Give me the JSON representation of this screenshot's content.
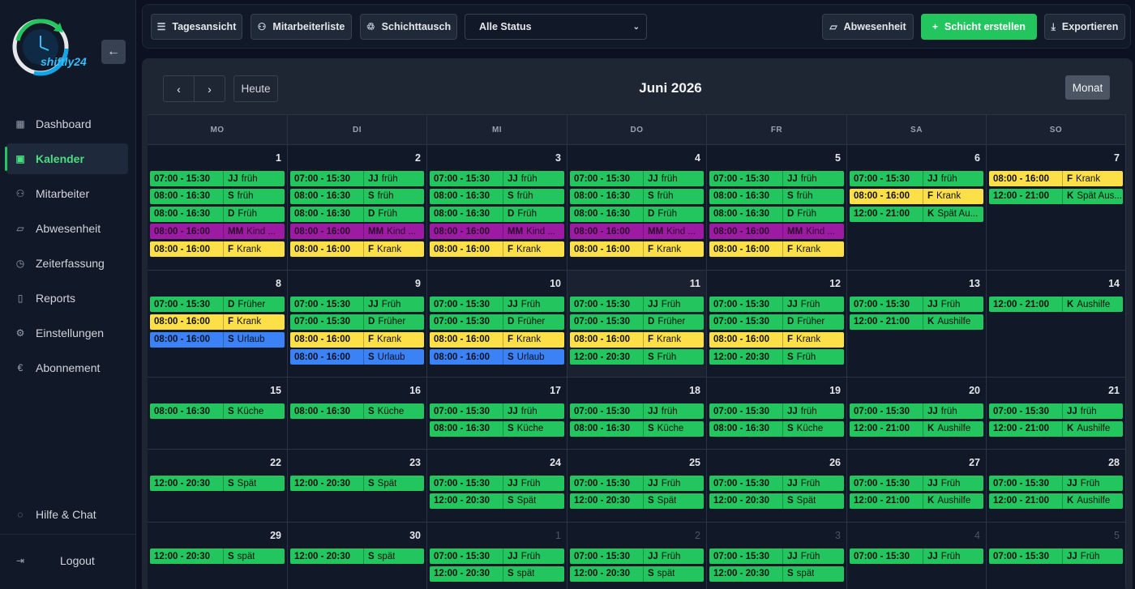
{
  "app": {
    "logo_text": "shiftly24"
  },
  "sidebar": {
    "items": [
      {
        "label": "Dashboard",
        "icon": "grid-icon",
        "glyph": "▦"
      },
      {
        "label": "Kalender",
        "icon": "calendar-icon",
        "glyph": "▣",
        "active": true
      },
      {
        "label": "Mitarbeiter",
        "icon": "user-icon",
        "glyph": "⚇"
      },
      {
        "label": "Abwesenheit",
        "icon": "folder-icon",
        "glyph": "▱"
      },
      {
        "label": "Zeiterfassung",
        "icon": "stopwatch-icon",
        "glyph": "◷"
      },
      {
        "label": "Reports",
        "icon": "book-icon",
        "glyph": "▯"
      },
      {
        "label": "Einstellungen",
        "icon": "gear-icon",
        "glyph": "⚙"
      },
      {
        "label": "Abonnement",
        "icon": "euro-icon",
        "glyph": "€"
      }
    ],
    "help": "Hilfe & Chat",
    "logout": "Logout"
  },
  "toolbar": {
    "tagesansicht": "Tagesansicht",
    "mitarbeiterliste": "Mitarbeiterliste",
    "schichttausch": "Schichttausch",
    "status_value": "Alle Status",
    "abwesenheit": "Abwesenheit",
    "schicht_erstellen": "Schicht erstellen",
    "exportieren": "Exportieren"
  },
  "calendar": {
    "title": "Juni 2026",
    "heute": "Heute",
    "view": "Monat",
    "weekdays": [
      "MO",
      "DI",
      "MI",
      "DO",
      "FR",
      "SA",
      "SO"
    ],
    "colors": {
      "g": "#22c55e",
      "y": "#fde047",
      "p": "#9d1ba3",
      "b": "#3b82f6"
    },
    "weeks": [
      [
        {
          "day": "1",
          "events": [
            [
              "07:00 - 15:30",
              "JJ",
              "früh",
              "g"
            ],
            [
              "08:00 - 16:30",
              "S",
              "früh",
              "g"
            ],
            [
              "08:00 - 16:30",
              "D",
              "Früh",
              "g"
            ],
            [
              "08:00 - 16:00",
              "MM",
              "Kind ...",
              "p"
            ],
            [
              "08:00 - 16:00",
              "F",
              "Krank",
              "y"
            ]
          ]
        },
        {
          "day": "2",
          "events": [
            [
              "07:00 - 15:30",
              "JJ",
              "früh",
              "g"
            ],
            [
              "08:00 - 16:30",
              "S",
              "früh",
              "g"
            ],
            [
              "08:00 - 16:30",
              "D",
              "Früh",
              "g"
            ],
            [
              "08:00 - 16:00",
              "MM",
              "Kind ...",
              "p"
            ],
            [
              "08:00 - 16:00",
              "F",
              "Krank",
              "y"
            ]
          ]
        },
        {
          "day": "3",
          "events": [
            [
              "07:00 - 15:30",
              "JJ",
              "früh",
              "g"
            ],
            [
              "08:00 - 16:30",
              "S",
              "früh",
              "g"
            ],
            [
              "08:00 - 16:30",
              "D",
              "Früh",
              "g"
            ],
            [
              "08:00 - 16:00",
              "MM",
              "Kind ...",
              "p"
            ],
            [
              "08:00 - 16:00",
              "F",
              "Krank",
              "y"
            ]
          ]
        },
        {
          "day": "4",
          "events": [
            [
              "07:00 - 15:30",
              "JJ",
              "früh",
              "g"
            ],
            [
              "08:00 - 16:30",
              "S",
              "früh",
              "g"
            ],
            [
              "08:00 - 16:30",
              "D",
              "Früh",
              "g"
            ],
            [
              "08:00 - 16:00",
              "MM",
              "Kind ...",
              "p"
            ],
            [
              "08:00 - 16:00",
              "F",
              "Krank",
              "y"
            ]
          ]
        },
        {
          "day": "5",
          "events": [
            [
              "07:00 - 15:30",
              "JJ",
              "früh",
              "g"
            ],
            [
              "08:00 - 16:30",
              "S",
              "früh",
              "g"
            ],
            [
              "08:00 - 16:30",
              "D",
              "Früh",
              "g"
            ],
            [
              "08:00 - 16:00",
              "MM",
              "Kind ...",
              "p"
            ],
            [
              "08:00 - 16:00",
              "F",
              "Krank",
              "y"
            ]
          ]
        },
        {
          "day": "6",
          "events": [
            [
              "07:00 - 15:30",
              "JJ",
              "früh",
              "g"
            ],
            [
              "08:00 - 16:00",
              "F",
              "Krank",
              "y"
            ],
            [
              "12:00 - 21:00",
              "K",
              "Spät Au...",
              "g"
            ]
          ]
        },
        {
          "day": "7",
          "events": [
            [
              "08:00 - 16:00",
              "F",
              "Krank",
              "y"
            ],
            [
              "12:00 - 21:00",
              "K",
              "Spät Aus...",
              "g"
            ]
          ]
        }
      ],
      [
        {
          "day": "8",
          "events": [
            [
              "07:00 - 15:30",
              "D",
              "Früher",
              "g"
            ],
            [
              "08:00 - 16:00",
              "F",
              "Krank",
              "y"
            ],
            [
              "08:00 - 16:00",
              "S",
              "Urlaub",
              "b"
            ]
          ]
        },
        {
          "day": "9",
          "events": [
            [
              "07:00 - 15:30",
              "JJ",
              "Früh",
              "g"
            ],
            [
              "07:00 - 15:30",
              "D",
              "Früher",
              "g"
            ],
            [
              "08:00 - 16:00",
              "F",
              "Krank",
              "y"
            ],
            [
              "08:00 - 16:00",
              "S",
              "Urlaub",
              "b"
            ]
          ]
        },
        {
          "day": "10",
          "events": [
            [
              "07:00 - 15:30",
              "JJ",
              "Früh",
              "g"
            ],
            [
              "07:00 - 15:30",
              "D",
              "Früher",
              "g"
            ],
            [
              "08:00 - 16:00",
              "F",
              "Krank",
              "y"
            ],
            [
              "08:00 - 16:00",
              "S",
              "Urlaub",
              "b"
            ]
          ]
        },
        {
          "day": "11",
          "today": true,
          "events": [
            [
              "07:00 - 15:30",
              "JJ",
              "Früh",
              "g"
            ],
            [
              "07:00 - 15:30",
              "D",
              "Früher",
              "g"
            ],
            [
              "08:00 - 16:00",
              "F",
              "Krank",
              "y"
            ],
            [
              "12:00 - 20:30",
              "S",
              "Früh",
              "g"
            ]
          ]
        },
        {
          "day": "12",
          "events": [
            [
              "07:00 - 15:30",
              "JJ",
              "Früh",
              "g"
            ],
            [
              "07:00 - 15:30",
              "D",
              "Früher",
              "g"
            ],
            [
              "08:00 - 16:00",
              "F",
              "Krank",
              "y"
            ],
            [
              "12:00 - 20:30",
              "S",
              "Früh",
              "g"
            ]
          ]
        },
        {
          "day": "13",
          "events": [
            [
              "07:00 - 15:30",
              "JJ",
              "Früh",
              "g"
            ],
            [
              "12:00 - 21:00",
              "K",
              "Aushilfe",
              "g"
            ]
          ]
        },
        {
          "day": "14",
          "events": [
            [
              "12:00 - 21:00",
              "K",
              "Aushilfe",
              "g"
            ]
          ]
        }
      ],
      [
        {
          "day": "15",
          "events": [
            [
              "08:00 - 16:30",
              "S",
              "Küche",
              "g"
            ]
          ]
        },
        {
          "day": "16",
          "events": [
            [
              "08:00 - 16:30",
              "S",
              "Küche",
              "g"
            ]
          ]
        },
        {
          "day": "17",
          "events": [
            [
              "07:00 - 15:30",
              "JJ",
              "früh",
              "g"
            ],
            [
              "08:00 - 16:30",
              "S",
              "Küche",
              "g"
            ]
          ]
        },
        {
          "day": "18",
          "events": [
            [
              "07:00 - 15:30",
              "JJ",
              "früh",
              "g"
            ],
            [
              "08:00 - 16:30",
              "S",
              "Küche",
              "g"
            ]
          ]
        },
        {
          "day": "19",
          "events": [
            [
              "07:00 - 15:30",
              "JJ",
              "früh",
              "g"
            ],
            [
              "08:00 - 16:30",
              "S",
              "Küche",
              "g"
            ]
          ]
        },
        {
          "day": "20",
          "events": [
            [
              "07:00 - 15:30",
              "JJ",
              "früh",
              "g"
            ],
            [
              "12:00 - 21:00",
              "K",
              "Aushilfe",
              "g"
            ]
          ]
        },
        {
          "day": "21",
          "events": [
            [
              "07:00 - 15:30",
              "JJ",
              "früh",
              "g"
            ],
            [
              "12:00 - 21:00",
              "K",
              "Aushilfe",
              "g"
            ]
          ]
        }
      ],
      [
        {
          "day": "22",
          "events": [
            [
              "12:00 - 20:30",
              "S",
              "Spät",
              "g"
            ]
          ]
        },
        {
          "day": "23",
          "events": [
            [
              "12:00 - 20:30",
              "S",
              "Spät",
              "g"
            ]
          ]
        },
        {
          "day": "24",
          "events": [
            [
              "07:00 - 15:30",
              "JJ",
              "Früh",
              "g"
            ],
            [
              "12:00 - 20:30",
              "S",
              "Spät",
              "g"
            ]
          ]
        },
        {
          "day": "25",
          "events": [
            [
              "07:00 - 15:30",
              "JJ",
              "Früh",
              "g"
            ],
            [
              "12:00 - 20:30",
              "S",
              "Spät",
              "g"
            ]
          ]
        },
        {
          "day": "26",
          "events": [
            [
              "07:00 - 15:30",
              "JJ",
              "Früh",
              "g"
            ],
            [
              "12:00 - 20:30",
              "S",
              "Spät",
              "g"
            ]
          ]
        },
        {
          "day": "27",
          "events": [
            [
              "07:00 - 15:30",
              "JJ",
              "Früh",
              "g"
            ],
            [
              "12:00 - 21:00",
              "K",
              "Aushilfe",
              "g"
            ]
          ]
        },
        {
          "day": "28",
          "events": [
            [
              "07:00 - 15:30",
              "JJ",
              "Früh",
              "g"
            ],
            [
              "12:00 - 21:00",
              "K",
              "Aushilfe",
              "g"
            ]
          ]
        }
      ],
      [
        {
          "day": "29",
          "events": [
            [
              "12:00 - 20:30",
              "S",
              "spät",
              "g"
            ]
          ]
        },
        {
          "day": "30",
          "events": [
            [
              "12:00 - 20:30",
              "S",
              "spät",
              "g"
            ]
          ]
        },
        {
          "day": "1",
          "other": true,
          "events": [
            [
              "07:00 - 15:30",
              "JJ",
              "Früh",
              "g"
            ],
            [
              "12:00 - 20:30",
              "S",
              "spät",
              "g"
            ]
          ]
        },
        {
          "day": "2",
          "other": true,
          "events": [
            [
              "07:00 - 15:30",
              "JJ",
              "Früh",
              "g"
            ],
            [
              "12:00 - 20:30",
              "S",
              "spät",
              "g"
            ]
          ]
        },
        {
          "day": "3",
          "other": true,
          "events": [
            [
              "07:00 - 15:30",
              "JJ",
              "Früh",
              "g"
            ],
            [
              "12:00 - 20:30",
              "S",
              "spät",
              "g"
            ]
          ]
        },
        {
          "day": "4",
          "other": true,
          "events": [
            [
              "07:00 - 15:30",
              "JJ",
              "Früh",
              "g"
            ]
          ]
        },
        {
          "day": "5",
          "other": true,
          "events": [
            [
              "07:00 - 15:30",
              "JJ",
              "Früh",
              "g"
            ]
          ]
        }
      ]
    ]
  }
}
